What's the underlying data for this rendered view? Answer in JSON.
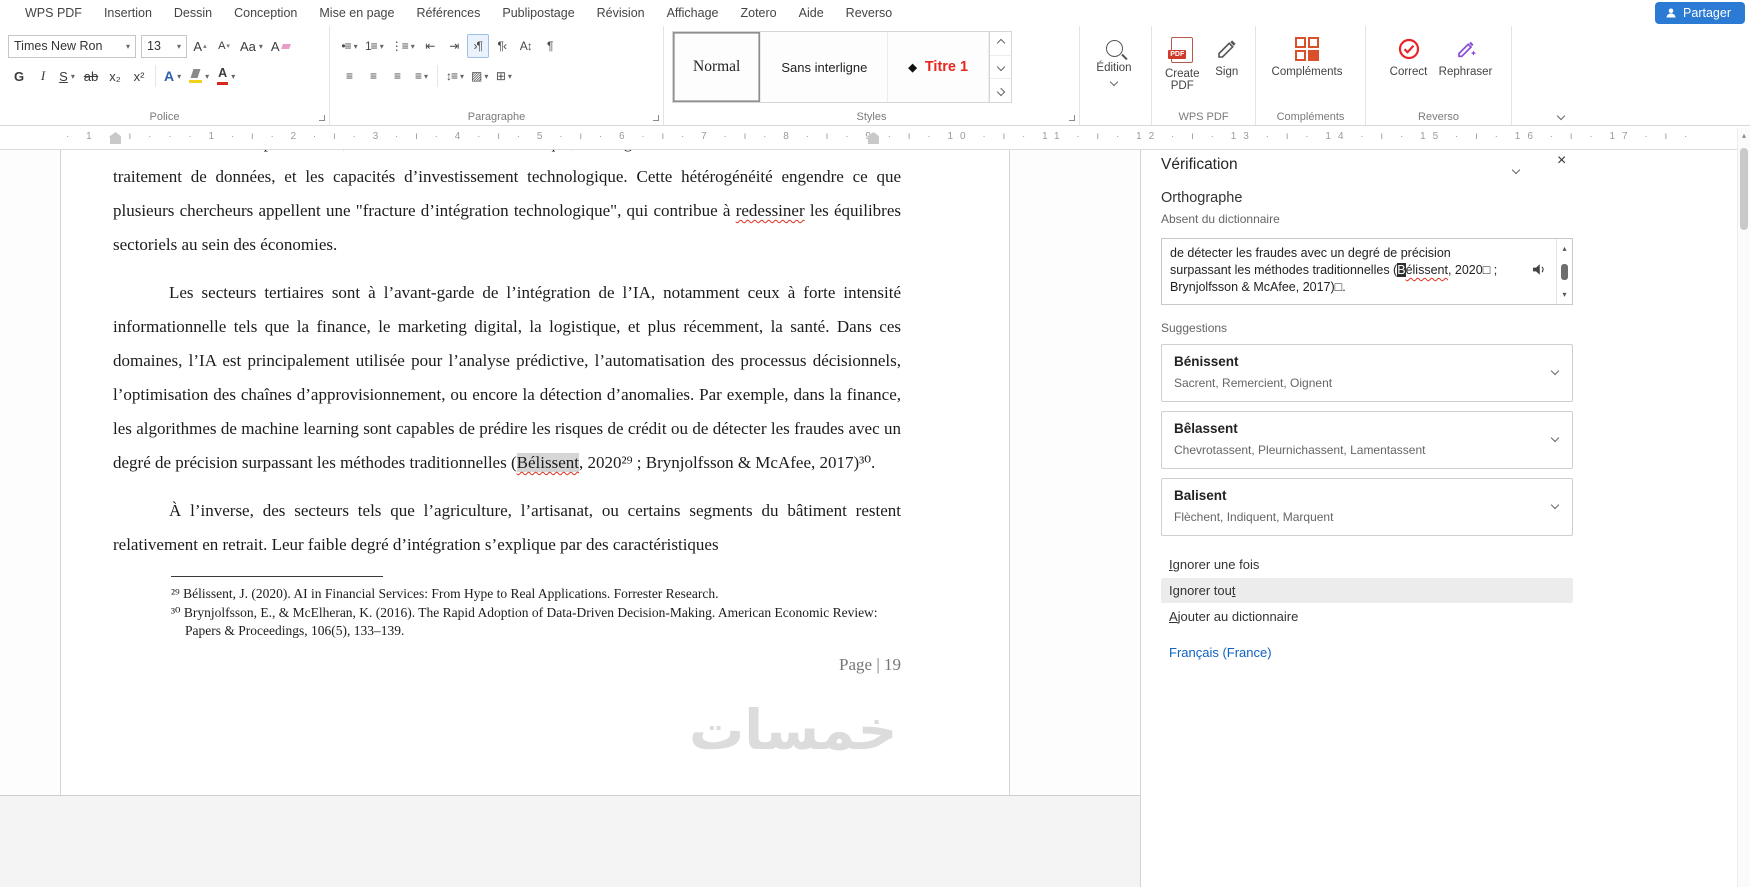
{
  "menubar": {
    "tabs": [
      {
        "label": "WPS PDF"
      },
      {
        "label": "Insertion"
      },
      {
        "label": "Dessin"
      },
      {
        "label": "Conception"
      },
      {
        "label": "Mise en page"
      },
      {
        "label": "Références"
      },
      {
        "label": "Publipostage"
      },
      {
        "label": "Révision"
      },
      {
        "label": "Affichage"
      },
      {
        "label": "Zotero"
      },
      {
        "label": "Aide"
      },
      {
        "label": "Reverso"
      }
    ],
    "share": "Partager"
  },
  "ribbon": {
    "font_name": "Times New Ron",
    "font_size": "13",
    "bold": "G",
    "italic": "I",
    "underline": "S",
    "strike": "ab",
    "subscript": "x₂",
    "superscript": "x²",
    "edition": "Édition",
    "create_pdf": "Create PDF",
    "sign": "Sign",
    "complements": "Compléments",
    "correct": "Correct",
    "rephraser": "Rephraser",
    "styles_gallery": [
      {
        "label": "Normal"
      },
      {
        "label": "Sans interligne"
      },
      {
        "label": "Titre 1"
      }
    ],
    "groups": {
      "police": "Police",
      "paragraphe": "Paragraphe",
      "styles": "Styles",
      "wps_pdf": "WPS PDF",
      "complements": "Compléments",
      "reverso": "Reverso"
    }
  },
  "icons": {
    "dropdown": "▾",
    "up": "▴",
    "down": "▾",
    "close": "×",
    "letter_a": "A",
    "change_case": "Aa",
    "diamond": "◆",
    "pdf_badge": "PDF",
    "bullets": "•≡",
    "numbering": "1≡",
    "multilevel": "⋮≡",
    "outdent": "⇤",
    "indent": "⇥",
    "ltr": "›¶",
    "rtl": "¶‹",
    "sort": "A↕",
    "pilcrow": "¶",
    "align": "≡",
    "line_spacing": "↕≡",
    "shading": "▨",
    "borders": "⊞"
  },
  "ruler": {
    "text": "· 1 · ı · · · 1 · ı · 2 · ı · 3 · ı · 4 · ı · 5 · ı · 6 · ı · 7 · ı · 8 · ı · 9 · ı · 10 · ı · 11 · ı · 12 · ı · 13 · ı · 14 · ı · 15 · ı · 16 · ı · 17 · ı ·"
  },
  "document": {
    "clipped_line": "diversité des activités productives, le niveau de maturité numérique, les exigences en matière de",
    "p1_a": "traitement de données, et les capacités d’investissement technologique. Cette hétérogénéité engendre ce que plusieurs chercheurs appellent une \"fracture d’intégration technologique\", qui contribue à ",
    "p1_misspelled": "redessiner",
    "p1_b": " les équilibres sectoriels au sein des économies.",
    "p2_a": "Les secteurs tertiaires sont à l’avant-garde de l’intégration de l’IA, notamment ceux à forte intensité informationnelle tels que la finance, le marketing digital, la logistique, et plus récemment, la santé. Dans ces domaines, l’IA est principalement utilisée pour l’analyse prédictive, l’automatisation des processus décisionnels, l’optimisation des chaînes d’approvisionnement, ou encore la détection d’anomalies. Par exemple, dans la finance, les algorithmes de machine learning sont capables de prédire les risques de crédit ou de détecter les fraudes avec un degré de précision surpassant les méthodes traditionnelles (",
    "p2_misspelled": "Bélissent",
    "p2_b": ", 2020²⁹ ; Brynjolfsson & McAfee, 2017)³⁰.",
    "p3": "À l’inverse, des secteurs tels que l’agriculture, l’artisanat, ou certains segments du bâtiment restent relativement en retrait. Leur faible degré d’intégration s’explique par des caractéristiques",
    "footnote_29": "²⁹ Bélissent, J. (2020). AI in Financial Services: From Hype to Real Applications. Forrester Research.",
    "footnote_30": "³⁰ Brynjolfsson, E., & McElheran, K. (2016). The Rapid Adoption of Data-Driven Decision-Making. American Economic Review: Papers & Proceedings, 106(5), 133–139.",
    "page_number": "Page | 19",
    "watermark": "خمسات"
  },
  "panel": {
    "title": "Vérification",
    "section": "Orthographe",
    "subtitle": "Absent du dictionnaire",
    "context_before": "de détecter les fraudes avec un degré de précision surpassant les méthodes traditionnelles (",
    "context_sel": "B",
    "context_word_rest": "élissent",
    "context_after": ", 2020□ ; Brynjolfsson & McAfee, 2017)□.",
    "suggestions_label": "Suggestions",
    "suggestions": [
      {
        "word": "Bénissent",
        "variants": "Sacrent, Remercient, Oignent"
      },
      {
        "word": "Bêlassent",
        "variants": "Chevrotassent, Pleurnichassent, Lamentassent"
      },
      {
        "word": "Balisent",
        "variants": "Flèchent, Indiquent, Marquent"
      }
    ],
    "actions": [
      {
        "pre": "",
        "key": "I",
        "post": "gnorer une fois"
      },
      {
        "pre": "Ignorer tou",
        "key": "t",
        "post": ""
      },
      {
        "pre": "",
        "key": "A",
        "post": "jouter au dictionnaire"
      }
    ],
    "language": "Français (France)"
  }
}
